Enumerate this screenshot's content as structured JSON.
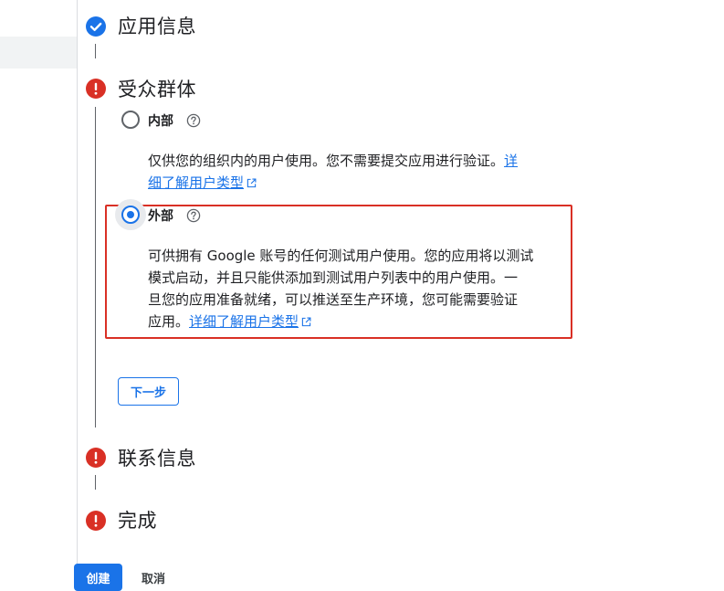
{
  "steps": {
    "app_info": {
      "title": "应用信息",
      "status": "complete"
    },
    "audience": {
      "title": "受众群体",
      "status": "error"
    },
    "contact": {
      "title": "联系信息",
      "status": "error"
    },
    "finish": {
      "title": "完成",
      "status": "error"
    }
  },
  "audience": {
    "internal": {
      "label": "内部",
      "selected": false,
      "desc_line1": "仅供您的组织内的用户使用。您不需要提交应用进行验证。",
      "link_part1": "详",
      "link_part2": "细了解用户类型"
    },
    "external": {
      "label": "外部",
      "selected": true,
      "desc_line1": "可供拥有 Google 账号的任何测试用户使用。您的应用将以测试",
      "desc_line2": "模式启动，并且只能供添加到测试用户列表中的用户使用。一",
      "desc_line3": "旦您的应用准备就绪，可以推送至生产环境，您可能需要验证",
      "desc_line4_prefix": "应用。",
      "link": "详细了解用户类型"
    },
    "next_label": "下一步"
  },
  "footer": {
    "create_label": "创建",
    "cancel_label": "取消"
  },
  "colors": {
    "accent": "#1a73e8",
    "error": "#d93025",
    "text": "#202124"
  },
  "icons": {
    "complete": "check-circle-icon",
    "error": "error-circle-icon",
    "help": "help-icon",
    "external_link": "open-in-new-icon"
  }
}
